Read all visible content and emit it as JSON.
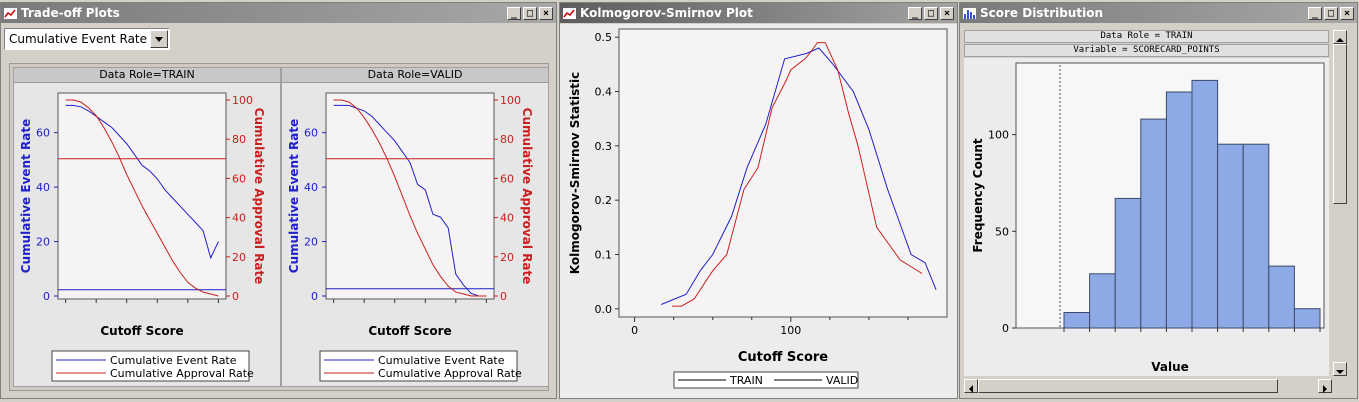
{
  "windows": {
    "tradeoff": {
      "title": "Trade-off Plots",
      "dropdown": {
        "selected": "Cumulative Event Rate"
      },
      "panels": [
        {
          "header": "Data Role=TRAIN"
        },
        {
          "header": "Data Role=VALID"
        }
      ],
      "xlabel": "Cutoff Score",
      "ylabel_left": "Cumulative Event Rate",
      "ylabel_right": "Cumulative Approval Rate",
      "left_ticks": [
        "0",
        "20",
        "40",
        "60"
      ],
      "right_ticks": [
        "0",
        "20",
        "40",
        "60",
        "80",
        "100"
      ],
      "legend": [
        "Cumulative Event Rate",
        "Cumulative Approval Rate"
      ]
    },
    "ks": {
      "title": "Kolmogorov-Smirnov Plot",
      "xlabel": "Cutoff Score",
      "ylabel": "Kolmogorov-Smirnov Statistic",
      "legend": [
        "TRAIN",
        "VALID"
      ]
    },
    "score": {
      "title": "Score Distribution",
      "header1": "Data Role = TRAIN",
      "header2": "Variable = SCORECARD_POINTS",
      "xlabel": "Value",
      "ylabel": "Frequency Count"
    }
  },
  "colors": {
    "blue": "#2020c8",
    "red": "#c82020",
    "bar": "#8eaae6",
    "bar_edge": "#3a4a6a"
  },
  "chart_data": [
    {
      "type": "line",
      "title": "Data Role=TRAIN",
      "xlabel": "Cutoff Score",
      "ylabel": "Cumulative Event Rate",
      "y2label": "Cumulative Approval Rate",
      "ylim": [
        0,
        72
      ],
      "y2lim": [
        0,
        100
      ],
      "series": [
        {
          "name": "Cumulative Event Rate",
          "axis": "left",
          "x": [
            0,
            1,
            2,
            3,
            4,
            5,
            6,
            7,
            8,
            9,
            10,
            11,
            12,
            13,
            14,
            15,
            16,
            17,
            18,
            19,
            20
          ],
          "values": [
            70,
            70,
            69.5,
            68,
            66,
            64,
            62,
            59,
            56,
            52,
            48,
            46,
            43,
            39,
            36,
            33,
            30,
            27,
            24,
            14,
            20
          ]
        },
        {
          "name": "Cumulative Approval Rate",
          "axis": "left",
          "x": [
            0,
            20
          ],
          "values": [
            2.3,
            2.3
          ]
        },
        {
          "name": "",
          "axis": "right",
          "x": [
            0,
            1,
            2,
            3,
            4,
            5,
            6,
            7,
            8,
            9,
            10,
            11,
            12,
            13,
            14,
            15,
            16,
            17,
            18,
            19,
            20
          ],
          "values": [
            100,
            100,
            99,
            96,
            92,
            86,
            79,
            71,
            62,
            54,
            46,
            39,
            32,
            25,
            18,
            12,
            7,
            4,
            2,
            1,
            0
          ]
        },
        {
          "name": "",
          "axis": "right",
          "x": [
            0,
            20
          ],
          "values": [
            70,
            70
          ]
        }
      ]
    },
    {
      "type": "line",
      "title": "Data Role=VALID",
      "xlabel": "Cutoff Score",
      "ylabel": "Cumulative Event Rate",
      "y2label": "Cumulative Approval Rate",
      "ylim": [
        0,
        72
      ],
      "y2lim": [
        0,
        100
      ],
      "series": [
        {
          "name": "Cumulative Event Rate",
          "axis": "left",
          "x": [
            0,
            1,
            2,
            3,
            4,
            5,
            6,
            7,
            8,
            9,
            10,
            11,
            12,
            13,
            14,
            15,
            16,
            17,
            18,
            19,
            20
          ],
          "values": [
            70,
            70,
            70,
            69,
            68,
            66,
            63,
            60,
            57,
            53,
            49,
            41,
            39,
            30,
            29,
            25,
            8,
            4,
            1,
            0,
            0
          ]
        },
        {
          "name": "Cumulative Approval Rate",
          "axis": "left",
          "x": [
            0,
            20
          ],
          "values": [
            2.7,
            2.7
          ]
        },
        {
          "name": "",
          "axis": "right",
          "x": [
            0,
            1,
            2,
            3,
            4,
            5,
            6,
            7,
            8,
            9,
            10,
            11,
            12,
            13,
            14,
            15,
            16,
            17,
            18,
            19,
            20
          ],
          "values": [
            100,
            100,
            99,
            96,
            91,
            85,
            78,
            70,
            61,
            51,
            41,
            32,
            24,
            16,
            10,
            5,
            2,
            1,
            0,
            0,
            0
          ]
        },
        {
          "name": "",
          "axis": "right",
          "x": [
            0,
            20
          ],
          "values": [
            70,
            70
          ]
        }
      ]
    },
    {
      "type": "line",
      "title": "Kolmogorov-Smirnov Plot",
      "xlabel": "Cutoff Score",
      "ylabel": "Kolmogorov-Smirnov Statistic",
      "xlim": [
        -10,
        200
      ],
      "ylim": [
        -0.015,
        0.515
      ],
      "xticks": [
        0,
        100
      ],
      "yticks": [
        0.0,
        0.1,
        0.2,
        0.3,
        0.4,
        0.5
      ],
      "series": [
        {
          "name": "TRAIN",
          "color": "blue",
          "x": [
            17,
            33,
            42,
            50,
            62,
            72,
            84,
            96,
            110,
            118,
            127,
            140,
            150,
            162,
            177,
            186,
            193
          ],
          "values": [
            0.008,
            0.027,
            0.07,
            0.1,
            0.17,
            0.26,
            0.34,
            0.46,
            0.47,
            0.48,
            0.45,
            0.4,
            0.33,
            0.22,
            0.1,
            0.085,
            0.035
          ]
        },
        {
          "name": "VALID",
          "color": "red",
          "x": [
            24,
            30,
            38,
            50,
            59,
            70,
            79,
            88,
            97,
            100,
            109,
            112,
            117,
            122,
            130,
            137,
            143,
            155,
            170,
            184
          ],
          "values": [
            0.005,
            0.005,
            0.018,
            0.07,
            0.1,
            0.22,
            0.26,
            0.37,
            0.42,
            0.44,
            0.46,
            0.47,
            0.49,
            0.49,
            0.44,
            0.36,
            0.3,
            0.15,
            0.09,
            0.065
          ]
        }
      ]
    },
    {
      "type": "bar",
      "title": "Score Distribution",
      "xlabel": "Value",
      "ylabel": "Frequency Count",
      "ylim": [
        0,
        137
      ],
      "yticks": [
        0,
        50,
        100
      ],
      "values": [
        8,
        28,
        67,
        108,
        122,
        128,
        95,
        95,
        32,
        10
      ]
    }
  ]
}
